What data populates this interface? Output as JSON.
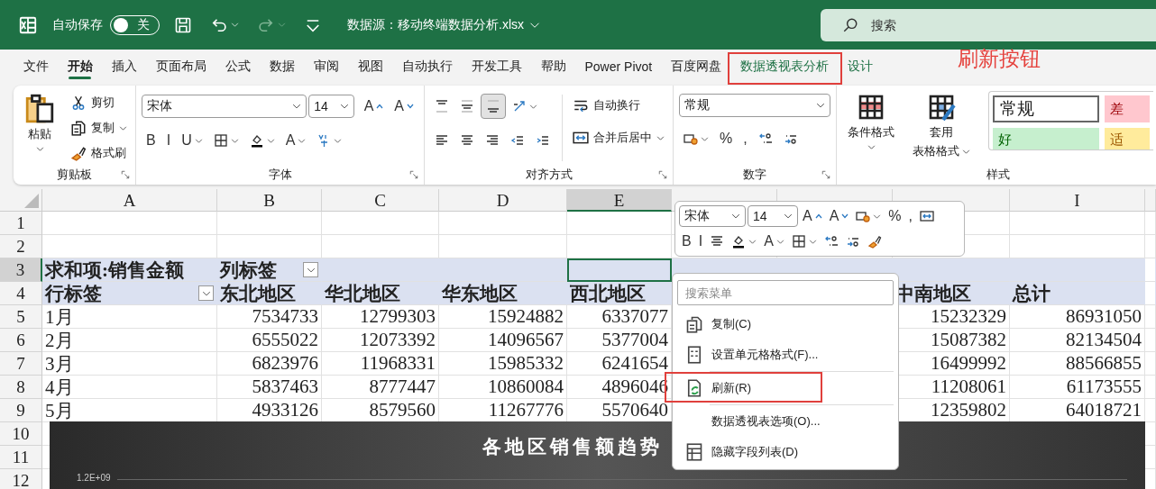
{
  "title_bar": {
    "autosave_label": "自动保存",
    "autosave": {
      "on": false,
      "label": "关"
    },
    "quick_access": [
      {
        "kind": "save",
        "caret": false,
        "disabled": false
      },
      {
        "kind": "undo",
        "caret": true,
        "disabled": false
      },
      {
        "kind": "redo",
        "caret": true,
        "disabled": true
      },
      {
        "kind": "customize",
        "caret": false,
        "disabled": false
      }
    ],
    "file_title": "数据源：移动终端数据分析.xlsx",
    "search": {
      "placeholder": "搜索"
    }
  },
  "tabs": [
    {
      "label": "文件",
      "selected": false,
      "contextual": false,
      "highlighted": false
    },
    {
      "label": "开始",
      "selected": true,
      "contextual": false,
      "highlighted": false
    },
    {
      "label": "插入",
      "selected": false,
      "contextual": false,
      "highlighted": false
    },
    {
      "label": "页面布局",
      "selected": false,
      "contextual": false,
      "highlighted": false
    },
    {
      "label": "公式",
      "selected": false,
      "contextual": false,
      "highlighted": false
    },
    {
      "label": "数据",
      "selected": false,
      "contextual": false,
      "highlighted": false
    },
    {
      "label": "审阅",
      "selected": false,
      "contextual": false,
      "highlighted": false
    },
    {
      "label": "视图",
      "selected": false,
      "contextual": false,
      "highlighted": false
    },
    {
      "label": "自动执行",
      "selected": false,
      "contextual": false,
      "highlighted": false
    },
    {
      "label": "开发工具",
      "selected": false,
      "contextual": false,
      "highlighted": false
    },
    {
      "label": "帮助",
      "selected": false,
      "contextual": false,
      "highlighted": false
    },
    {
      "label": "Power Pivot",
      "selected": false,
      "contextual": false,
      "highlighted": false
    },
    {
      "label": "百度网盘",
      "selected": false,
      "contextual": false,
      "highlighted": false
    },
    {
      "label": "数据透视表分析",
      "selected": false,
      "contextual": true,
      "highlighted": true
    },
    {
      "label": "设计",
      "selected": false,
      "contextual": true,
      "highlighted": false
    }
  ],
  "annotation": {
    "text": "刷新按钮"
  },
  "ribbon": {
    "clipboard": {
      "label": "剪贴板",
      "paste": "粘贴",
      "items": [
        {
          "kind": "cut",
          "label": "剪切",
          "caret": false
        },
        {
          "kind": "copy",
          "label": "复制",
          "caret": true
        },
        {
          "kind": "painter",
          "label": "格式刷",
          "caret": false
        }
      ]
    },
    "font": {
      "label": "字体",
      "font": "宋体",
      "size": "14",
      "row1": [
        {
          "kind": "grow-font",
          "label": "A",
          "caret": false
        },
        {
          "kind": "shrink-font",
          "label": "A",
          "caret": false
        }
      ],
      "row2": [
        {
          "kind": "bold",
          "label": "B",
          "caret": false
        },
        {
          "kind": "italic",
          "label": "I",
          "caret": false
        },
        {
          "kind": "underline",
          "label": "U",
          "caret": true
        },
        {
          "kind": "borders",
          "caret": true
        },
        {
          "kind": "fill-color",
          "caret": true
        },
        {
          "kind": "font-color",
          "label": "A",
          "caret": true
        },
        {
          "kind": "phonetic",
          "caret": true
        }
      ]
    },
    "alignment": {
      "label": "对齐方式",
      "row1": [
        {
          "kind": "align-top",
          "caret": false,
          "selected": false
        },
        {
          "kind": "align-middle",
          "caret": false,
          "selected": false
        },
        {
          "kind": "align-bottom",
          "caret": false,
          "selected": true
        },
        {
          "kind": "orientation",
          "caret": true,
          "selected": false
        }
      ],
      "row2": [
        {
          "kind": "align-left",
          "caret": false,
          "selected": false
        },
        {
          "kind": "align-center",
          "caret": false,
          "selected": false
        },
        {
          "kind": "align-right",
          "caret": false,
          "selected": false
        },
        {
          "kind": "outdent",
          "caret": false,
          "selected": false
        },
        {
          "kind": "indent",
          "caret": false,
          "selected": false
        }
      ],
      "wrap": "自动换行",
      "merge": "合并后居中"
    },
    "number": {
      "label": "数字",
      "format": "常规",
      "tools": [
        {
          "kind": "accounting",
          "caret": true
        },
        {
          "kind": "percent",
          "label": "%",
          "caret": false
        },
        {
          "kind": "comma-style",
          "label": ",",
          "caret": false
        },
        {
          "kind": "increase-decimal",
          "caret": false
        },
        {
          "kind": "decrease-decimal",
          "caret": false
        }
      ]
    },
    "styles": {
      "label": "样式",
      "conditional": "条件格式",
      "table_format": [
        "套用",
        "表格格式"
      ],
      "cells": [
        {
          "text": "常规",
          "kind": "normal"
        },
        {
          "text": "差",
          "kind": "bad"
        },
        {
          "text": "好",
          "kind": "good"
        },
        {
          "text": "适",
          "kind": "neutral"
        }
      ]
    }
  },
  "grid": {
    "columns": [
      {
        "label": "A",
        "selected": false
      },
      {
        "label": "B",
        "selected": false
      },
      {
        "label": "C",
        "selected": false
      },
      {
        "label": "D",
        "selected": false
      },
      {
        "label": "E",
        "selected": true
      },
      {
        "selected": false
      },
      {
        "selected": false
      },
      {
        "selected": false
      },
      {
        "label": "I",
        "selected": false
      }
    ],
    "rows": [
      {
        "number": "1",
        "selected": false,
        "kind": "blank"
      },
      {
        "number": "2",
        "selected": false,
        "kind": "blank"
      },
      {
        "number": "3",
        "selected": true,
        "kind": "pivot",
        "cells": [
          {
            "text": "求和项:销售金额",
            "filter": false
          },
          {
            "text": "列标签",
            "filter": true
          }
        ]
      },
      {
        "number": "4",
        "selected": false,
        "kind": "pivot",
        "cells": [
          {
            "text": "行标签",
            "filter": true
          },
          {
            "text": "东北地区",
            "filter": false
          },
          {
            "text": "华北地区",
            "filter": false
          },
          {
            "text": "华东地区",
            "filter": false
          },
          {
            "text": "西北地区",
            "filter": false
          },
          null,
          null,
          {
            "text": "中南地区",
            "filter": false
          },
          {
            "text": "总计",
            "filter": false
          }
        ]
      },
      {
        "number": "5",
        "selected": false,
        "kind": "data",
        "cells": [
          "1月",
          "7534733",
          "12799303",
          "15924882",
          "6337077",
          null,
          null,
          "15232329",
          "86931050"
        ]
      },
      {
        "number": "6",
        "selected": false,
        "kind": "data",
        "cells": [
          "2月",
          "6555022",
          "12073392",
          "14096567",
          "5377004",
          null,
          null,
          "15087382",
          "82134504"
        ]
      },
      {
        "number": "7",
        "selected": false,
        "kind": "data",
        "cells": [
          "3月",
          "6823976",
          "11968331",
          "15985332",
          "6241654",
          null,
          null,
          "16499992",
          "88566855"
        ]
      },
      {
        "number": "8",
        "selected": false,
        "kind": "data",
        "cells": [
          "4月",
          "5837463",
          "8777447",
          "10860084",
          "4896046",
          null,
          null,
          "11208061",
          "61173555"
        ]
      },
      {
        "number": "9",
        "selected": false,
        "kind": "data",
        "cells": [
          "5月",
          "4933126",
          "8579560",
          "11267776",
          "5570640",
          null,
          null,
          "12359802",
          "64018721"
        ]
      },
      {
        "number": "10",
        "selected": false,
        "kind": "blank"
      },
      {
        "number": "11",
        "selected": false,
        "kind": "blank"
      },
      {
        "number": "12",
        "selected": false,
        "kind": "blank"
      }
    ]
  },
  "chart": {
    "title": "各地区销售额趋势",
    "y_tick": "1.2E+09"
  },
  "mini_toolbar": {
    "font": "宋体",
    "size": "14",
    "row1": [
      {
        "kind": "grow-font",
        "label": "A",
        "caret": false
      },
      {
        "kind": "shrink-font",
        "label": "A",
        "caret": false
      },
      {
        "kind": "accounting",
        "caret": true
      },
      {
        "kind": "percent",
        "label": "%",
        "caret": false
      },
      {
        "kind": "comma-style",
        "label": ",",
        "caret": false
      },
      {
        "kind": "merge",
        "caret": false
      }
    ],
    "row2": [
      {
        "kind": "bold",
        "label": "B",
        "caret": false
      },
      {
        "kind": "italic",
        "label": "I",
        "caret": false
      },
      {
        "kind": "align-center",
        "caret": false
      },
      {
        "kind": "fill-color",
        "caret": true
      },
      {
        "kind": "font-color",
        "label": "A",
        "caret": true
      },
      {
        "kind": "borders",
        "caret": true
      },
      {
        "kind": "increase-decimal",
        "caret": false
      },
      {
        "kind": "decrease-decimal",
        "caret": false
      },
      {
        "kind": "painter",
        "caret": false
      }
    ]
  },
  "context_menu": {
    "search": {
      "placeholder": "搜索菜单"
    },
    "items": [
      {
        "kind": "copy",
        "label": "复制(C)",
        "separator_before": false,
        "highlighted": false
      },
      {
        "kind": "format-cells",
        "label": "设置单元格格式(F)...",
        "separator_before": false,
        "highlighted": false
      },
      {
        "kind": "refresh",
        "label": "刷新(R)",
        "separator_before": true,
        "highlighted": true
      },
      {
        "kind": "options",
        "label": "数据透视表选项(O)...",
        "separator_before": true,
        "highlighted": false
      },
      {
        "kind": "field-list",
        "label": "隐藏字段列表(D)",
        "separator_before": false,
        "highlighted": false
      }
    ]
  }
}
